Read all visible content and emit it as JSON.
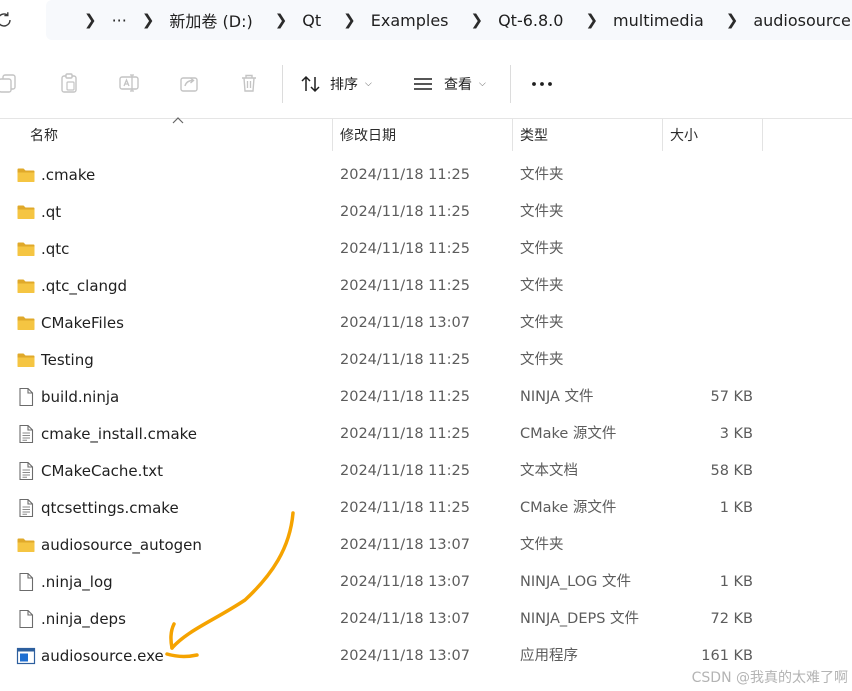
{
  "breadcrumb": {
    "overflow": "···",
    "items": [
      "新加卷 (D:)",
      "Qt",
      "Examples",
      "Qt-6.8.0",
      "multimedia",
      "audiosource"
    ]
  },
  "toolbar": {
    "sort_label": "排序",
    "view_label": "查看",
    "more_label": "···"
  },
  "columns": {
    "name": "名称",
    "modified": "修改日期",
    "type": "类型",
    "size": "大小"
  },
  "files": [
    {
      "name": ".cmake",
      "modified": "2024/11/18 11:25",
      "type": "文件夹",
      "size": "",
      "icon": "folder-icon"
    },
    {
      "name": ".qt",
      "modified": "2024/11/18 11:25",
      "type": "文件夹",
      "size": "",
      "icon": "folder-icon"
    },
    {
      "name": ".qtc",
      "modified": "2024/11/18 11:25",
      "type": "文件夹",
      "size": "",
      "icon": "folder-icon"
    },
    {
      "name": ".qtc_clangd",
      "modified": "2024/11/18 11:25",
      "type": "文件夹",
      "size": "",
      "icon": "folder-icon"
    },
    {
      "name": "CMakeFiles",
      "modified": "2024/11/18 13:07",
      "type": "文件夹",
      "size": "",
      "icon": "folder-icon"
    },
    {
      "name": "Testing",
      "modified": "2024/11/18 11:25",
      "type": "文件夹",
      "size": "",
      "icon": "folder-icon"
    },
    {
      "name": "build.ninja",
      "modified": "2024/11/18 11:25",
      "type": "NINJA 文件",
      "size": "57 KB",
      "icon": "file-icon"
    },
    {
      "name": "cmake_install.cmake",
      "modified": "2024/11/18 11:25",
      "type": "CMake 源文件",
      "size": "3 KB",
      "icon": "text-file-icon"
    },
    {
      "name": "CMakeCache.txt",
      "modified": "2024/11/18 11:25",
      "type": "文本文档",
      "size": "58 KB",
      "icon": "text-file-icon"
    },
    {
      "name": "qtcsettings.cmake",
      "modified": "2024/11/18 11:25",
      "type": "CMake 源文件",
      "size": "1 KB",
      "icon": "text-file-icon"
    },
    {
      "name": "audiosource_autogen",
      "modified": "2024/11/18 13:07",
      "type": "文件夹",
      "size": "",
      "icon": "folder-icon"
    },
    {
      "name": ".ninja_log",
      "modified": "2024/11/18 13:07",
      "type": "NINJA_LOG 文件",
      "size": "1 KB",
      "icon": "file-icon"
    },
    {
      "name": ".ninja_deps",
      "modified": "2024/11/18 13:07",
      "type": "NINJA_DEPS 文件",
      "size": "72 KB",
      "icon": "file-icon"
    },
    {
      "name": "audiosource.exe",
      "modified": "2024/11/18 13:07",
      "type": "应用程序",
      "size": "161 KB",
      "icon": "exe-icon"
    }
  ],
  "watermark": "CSDN @我真的太难了啊",
  "colors": {
    "folder": "#f5c542",
    "annotation": "#f5a300",
    "addressbar": "#f7f9fc"
  }
}
